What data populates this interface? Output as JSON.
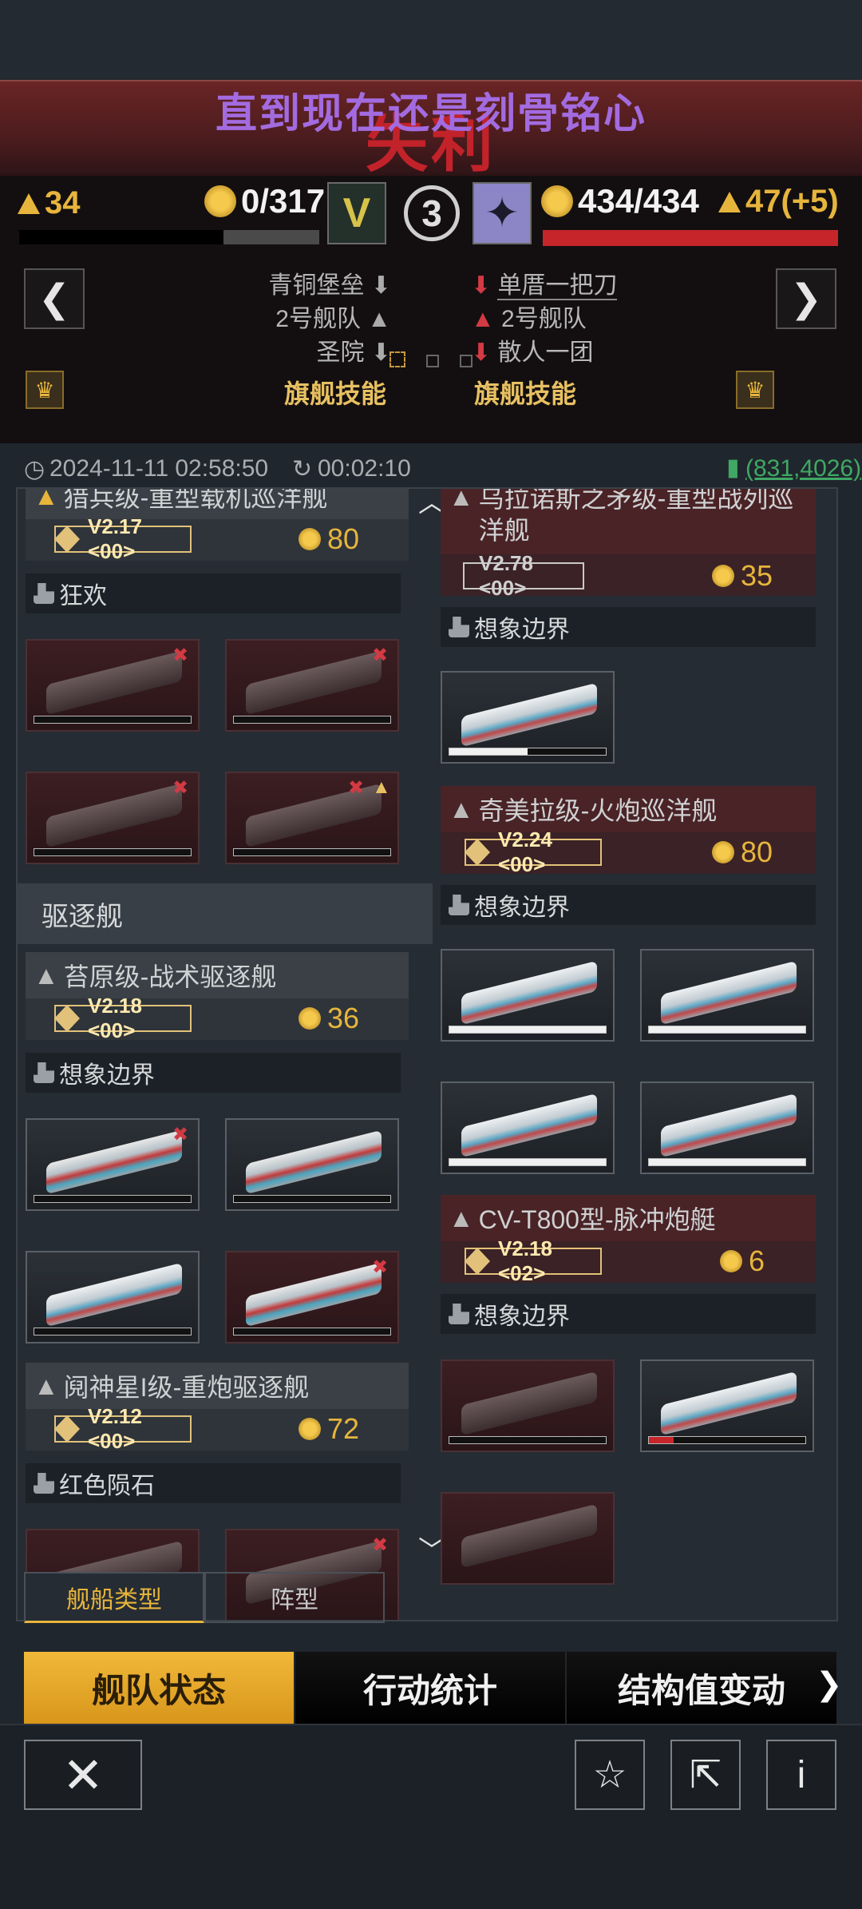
{
  "overlay_text": "直到现在还是刻骨铭心",
  "result_title": "失利",
  "left": {
    "level": "34",
    "score": "0/317",
    "rank_letter": "V",
    "fleets": [
      {
        "name": "青铜堡垒"
      },
      {
        "name": "2号舰队"
      },
      {
        "name": "圣院"
      }
    ],
    "skill_label": "旗舰技能"
  },
  "round_number": "3",
  "right": {
    "level": "47(+5)",
    "score": "434/434",
    "fleets": [
      {
        "name": "单厝一把刀"
      },
      {
        "name": "2号舰队"
      },
      {
        "name": "散人一团"
      }
    ],
    "skill_label": "旗舰技能"
  },
  "nav": {
    "prev": "❮",
    "next": "❯"
  },
  "info": {
    "datetime": "2024-11-11 02:58:50",
    "duration": "00:02:10",
    "coords": "(831,4026)"
  },
  "left_column": {
    "ship1": {
      "name": "猎兵级-重型载机巡洋舰",
      "level": "V2.17 <00>",
      "cost": "80",
      "captain": "狂欢"
    },
    "section": "驱逐舰",
    "ship2": {
      "name": "苔原级-战术驱逐舰",
      "level": "V2.18 <00>",
      "cost": "36",
      "captain": "想象边界"
    },
    "ship3": {
      "name": "阋神星I级-重炮驱逐舰",
      "level": "V2.12 <00>",
      "cost": "72",
      "captain": "红色陨石"
    }
  },
  "right_column": {
    "ship1": {
      "name": "乌拉诺斯之矛级-重型战列巡洋舰",
      "level": "V2.78 <00>",
      "cost": "35",
      "captain": "想象边界"
    },
    "ship2": {
      "name": "奇美拉级-火炮巡洋舰",
      "level": "V2.24 <00>",
      "cost": "80",
      "captain": "想象边界"
    },
    "ship3": {
      "name": "CV-T800型-脉冲炮艇",
      "level": "V2.18 <02>",
      "cost": "6",
      "captain": "想象边界"
    }
  },
  "sub_tabs": [
    "舰船类型",
    "阵型"
  ],
  "main_tabs": [
    "舰队状态",
    "行动统计",
    "结构值变动"
  ],
  "bottom": {
    "close": "✕",
    "star": "☆",
    "share": "⇱",
    "info": "i"
  },
  "colors": {
    "gold": "#e7b53c",
    "red": "#c6252a",
    "active_tab": "#f1b83a"
  }
}
